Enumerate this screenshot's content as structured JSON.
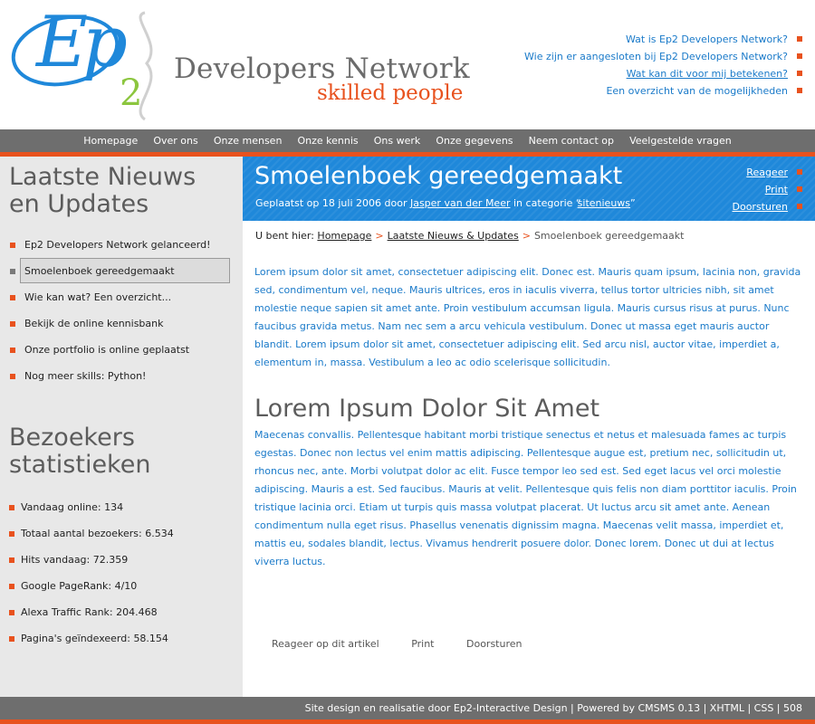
{
  "header": {
    "logo": {
      "mark": "Ep",
      "sub": "2",
      "name": "Developers Network",
      "tagline": "skilled people"
    },
    "top_links": [
      {
        "label": "Wat is Ep2 Developers Network?"
      },
      {
        "label": "Wie zijn er aangesloten bij Ep2 Developers Network?"
      },
      {
        "label": "Wat kan dit voor mij betekenen?"
      },
      {
        "label": "Een overzicht van de mogelijkheden"
      }
    ]
  },
  "nav": {
    "items": [
      "Homepage",
      "Over ons",
      "Onze mensen",
      "Onze kennis",
      "Ons werk",
      "Onze gegevens",
      "Neem contact op",
      "Veelgestelde vragen"
    ]
  },
  "sidebar": {
    "news_title_line1": "Laatste Nieuws",
    "news_title_line2": "en Updates",
    "news_items": [
      "Ep2 Developers Network gelanceerd!",
      "Smoelenboek gereedgemaakt",
      "Wie kan wat? Een overzicht...",
      "Bekijk de online kennisbank",
      "Onze portfolio is online geplaatst",
      "Nog meer skills: Python!"
    ],
    "stats_title_line1": "Bezoekers",
    "stats_title_line2": "statistieken",
    "stats_items": [
      "Vandaag online: 134",
      "Totaal aantal bezoekers: 6.534",
      "Hits vandaag: 72.359",
      "Google PageRank: 4/10",
      "Alexa Traffic Rank: 204.468",
      "Pagina's geïndexeerd: 58.154"
    ]
  },
  "article": {
    "title": "Smoelenboek gereedgemaakt",
    "meta_prefix": "Geplaatst op 18 juli 2006 door",
    "author": "Jasper van der Meer",
    "meta_mid": "in categorie “",
    "category": "sitenieuws",
    "meta_suffix": "”",
    "actions": [
      "Reageer",
      "Print",
      "Doorsturen"
    ],
    "breadcrumb": {
      "prefix": "U bent hier:",
      "home": "Homepage",
      "section": "Laatste Nieuws & Updates",
      "current": "Smoelenboek gereedgemaakt",
      "separator": ">"
    },
    "paragraph1": "Lorem ipsum dolor sit amet, consectetuer adipiscing elit. Donec est. Mauris quam ipsum, lacinia non, gravida sed, condimentum vel, neque. Mauris ultrices, eros in iaculis viverra, tellus tortor ultricies nibh, sit amet molestie neque sapien sit amet ante. Proin vestibulum accumsan ligula. Mauris cursus risus at purus. Nunc faucibus gravida metus. Nam nec sem a arcu vehicula vestibulum. Donec ut massa eget mauris auctor blandit. Lorem ipsum dolor sit amet, consectetuer adipiscing elit. Sed arcu nisl, auctor vitae, imperdiet a, elementum in, massa. Vestibulum a leo ac odio scelerisque sollicitudin.",
    "heading2": "Lorem Ipsum Dolor Sit Amet",
    "paragraph2": "Maecenas convallis. Pellentesque habitant morbi tristique senectus et netus et malesuada fames ac turpis egestas. Donec non lectus vel enim mattis adipiscing. Pellentesque augue est, pretium nec, sollicitudin ut, rhoncus nec, ante. Morbi volutpat dolor ac elit. Fusce tempor leo sed est. Sed eget lacus vel orci molestie adipiscing. Mauris a est. Sed faucibus. Mauris at velit. Pellentesque quis felis non diam porttitor iaculis. Proin tristique lacinia orci. Etiam ut turpis quis massa volutpat placerat. Ut luctus arcu sit amet ante. Aenean condimentum nulla eget risus. Phasellus venenatis dignissim magna. Maecenas velit massa, imperdiet et, mattis eu, sodales blandit, lectus. Vivamus hendrerit posuere dolor. Donec lorem. Donec ut dui at lectus viverra luctus.",
    "bottom_links": [
      "Reageer op dit artikel",
      "Print",
      "Doorsturen"
    ]
  },
  "footer": {
    "text": "Site design en realisatie door Ep2-Interactive Design | Powered by CMSMS 0.13 | XHTML | CSS | 508"
  },
  "colors": {
    "accent_orange": "#e8521e",
    "link_blue": "#1a7ac9",
    "banner_blue": "#1f88da",
    "bar_grey": "#6e6e6e",
    "sidebar_grey": "#e8e8e8",
    "logo_green": "#8cc63f"
  }
}
